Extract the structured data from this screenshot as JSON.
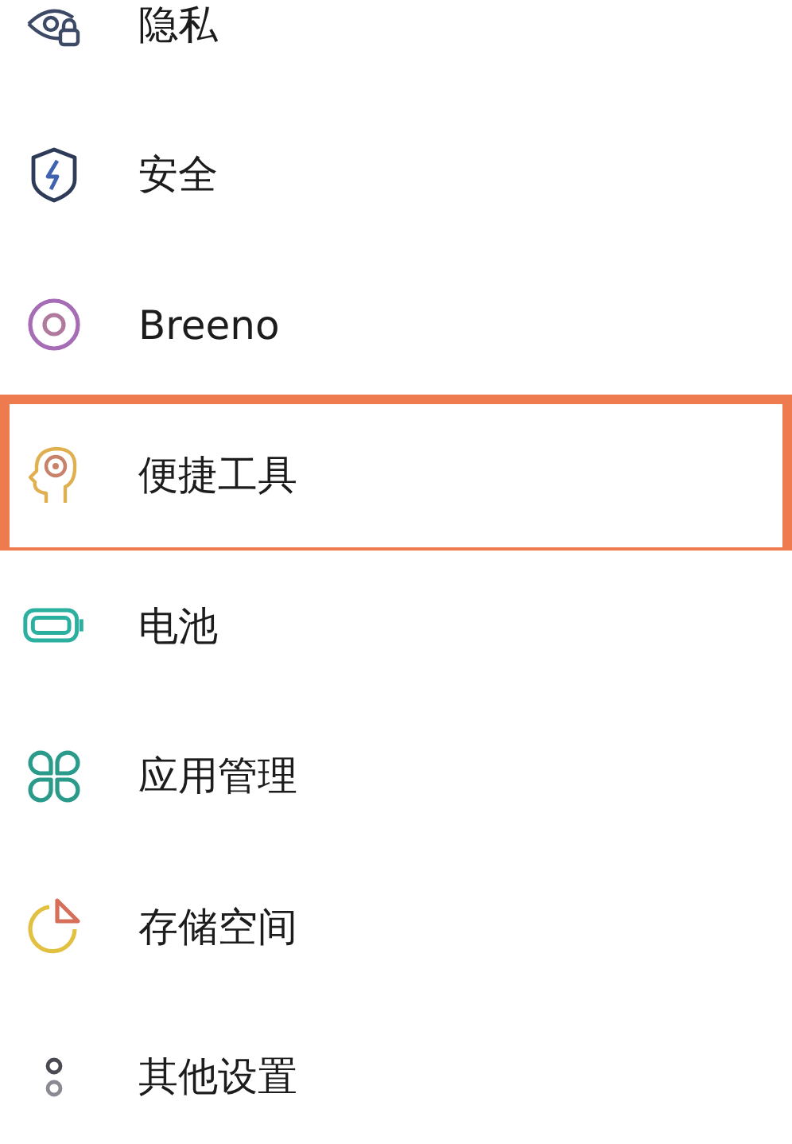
{
  "settings": [
    {
      "kind": "privacy",
      "label": "隐私",
      "selected": false
    },
    {
      "kind": "security",
      "label": "安全",
      "selected": false
    },
    {
      "kind": "assistant",
      "label": "Breeno",
      "selected": false
    },
    {
      "kind": "tools",
      "label": "便捷工具",
      "selected": true
    },
    {
      "kind": "battery",
      "label": "电池",
      "selected": false
    },
    {
      "kind": "apps",
      "label": "应用管理",
      "selected": false
    },
    {
      "kind": "storage",
      "label": "存储空间",
      "selected": false
    },
    {
      "kind": "other",
      "label": "其他设置",
      "selected": false
    }
  ]
}
